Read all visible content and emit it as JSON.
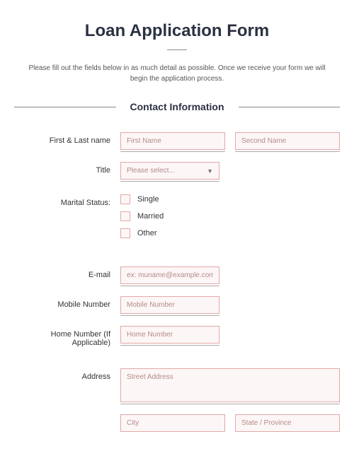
{
  "title": "Loan Application Form",
  "intro": "Please fill out the fields below in as much detail as possible. Once we receive your form we will begin the application process.",
  "section1": "Contact Information",
  "labels": {
    "name": "First & Last name",
    "title": "Title",
    "marital": "Marital Status:",
    "email": "E-mail",
    "mobile": "Mobile Number",
    "home": "Home Number (If Applicable)",
    "address": "Address"
  },
  "placeholders": {
    "first_name": "First Name",
    "second_name": "Second Name",
    "title_select": "Please select...",
    "email": "ex: muname@example.com",
    "mobile": "Mobile Number",
    "home": "Home Number",
    "street": "Street Address",
    "city": "City",
    "state": "State / Province"
  },
  "marital_options": {
    "single": "Single",
    "married": "Married",
    "other": "Other"
  }
}
